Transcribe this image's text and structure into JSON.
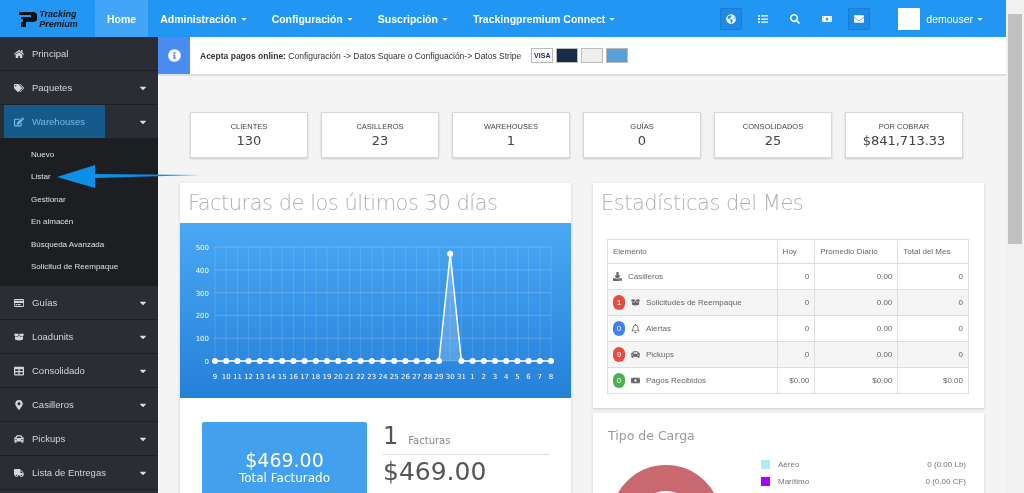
{
  "logo": {
    "line_1": "Tracking",
    "line_2": "Premium"
  },
  "nav": {
    "items": [
      {
        "label": "Home",
        "selected": true
      },
      {
        "label": "Administración",
        "selected": false
      },
      {
        "label": "Configuración",
        "selected": false
      },
      {
        "label": "Suscripción",
        "selected": false
      },
      {
        "label": "Trackingpremium Connect",
        "selected": false
      }
    ],
    "user": "demouser"
  },
  "sidebar": {
    "items": [
      {
        "label": "Principal",
        "selected": false
      },
      {
        "label": "Paquetes",
        "selected": false
      },
      {
        "label": "Warehouses",
        "selected": true,
        "children": [
          {
            "label": "Nuevo"
          },
          {
            "label": "Listar"
          },
          {
            "label": "Gestionar"
          },
          {
            "label": "En almacén"
          },
          {
            "label": "Búsqueda Avanzada"
          },
          {
            "label": "Solicitud de Reempaque"
          }
        ]
      },
      {
        "label": "Guías",
        "selected": false
      },
      {
        "label": "Loadunits",
        "selected": false
      },
      {
        "label": "Consolidado",
        "selected": false
      },
      {
        "label": "Casilleros",
        "selected": false
      },
      {
        "label": "Pickups",
        "selected": false
      },
      {
        "label": "Lista de Entregas",
        "selected": false
      }
    ]
  },
  "alert": {
    "text": "**Acepta pagos online:** Configuración -> Datos Square o Configuación-> Datos Stripe",
    "cards": [
      {
        "kind": "visa",
        "label": "VISA"
      },
      {
        "kind": "mastercard"
      },
      {
        "kind": "discover"
      },
      {
        "kind": "amex"
      }
    ]
  },
  "stats": [
    {
      "label": "CLIENTES",
      "value": "130"
    },
    {
      "label": "CASILLEROS",
      "value": "23"
    },
    {
      "label": "WAREHOUSES",
      "value": "1"
    },
    {
      "label": "GUÍAS",
      "value": "0"
    },
    {
      "label": "CONSOLIDADOS",
      "value": "25"
    },
    {
      "label": "POR COBRAR",
      "value": "$841,713.33"
    }
  ],
  "invoices": {
    "title": "Facturas de los últimos 30 días",
    "chart_data": {
      "type": "area",
      "categories": [
        "9",
        "10",
        "11",
        "12",
        "13",
        "14",
        "15",
        "16",
        "17",
        "18",
        "19",
        "20",
        "21",
        "22",
        "23",
        "24",
        "25",
        "26",
        "27",
        "28",
        "29",
        "30",
        "31",
        "1",
        "2",
        "3",
        "4",
        "5",
        "6",
        "7",
        "8"
      ],
      "series": [
        {
          "color": "#ffffff",
          "values": [
            0,
            0,
            0,
            0,
            0,
            0,
            0,
            0,
            0,
            0,
            0,
            0,
            0,
            0,
            0,
            0,
            0,
            0,
            0,
            0,
            0,
            470,
            0,
            0,
            0,
            0,
            0,
            0,
            0,
            0,
            0
          ]
        }
      ],
      "ylim": [
        0,
        500
      ],
      "grid": true,
      "yticks": [
        0,
        100,
        200,
        300,
        400,
        500
      ]
    },
    "total": {
      "amount": "$469.00",
      "label": "Total Facturado"
    },
    "count": "1",
    "count_label": "Facturas",
    "sum": "$469.00"
  },
  "month_stats": {
    "title": "Estadísticas del Mes",
    "columns": [
      "Elemento",
      "Hoy",
      "Promedio Diario",
      "Total del Mes"
    ],
    "rows": [
      {
        "cells": [
          "Casilleros",
          "0",
          "0.00",
          "0"
        ]
      },
      {
        "badge": "1",
        "color": "#e74c3c",
        "cells": [
          "Solicitudes de Reempaque",
          "0",
          "0.00",
          "0"
        ]
      },
      {
        "badge": "0",
        "color": "#3b82f6",
        "cells": [
          "Alertas",
          "0",
          "0.00",
          "0"
        ]
      },
      {
        "badge": "9",
        "color": "#e74c3c",
        "cells": [
          "Pickups",
          "0",
          "0.00",
          "0"
        ]
      },
      {
        "badge": "0",
        "color": "#4caf50",
        "cells": [
          "Pagos Recibidos",
          "$0.00",
          "$0.00",
          "$0.00"
        ]
      }
    ]
  },
  "cargo": {
    "title": "Tipo de Carga",
    "legend": [
      {
        "label": "Aéreo",
        "value": "0 (0.00 Lb)",
        "color": "#b2ebee"
      },
      {
        "label": "Marítimo",
        "value": "0 (0.00 CF)",
        "color": "#aa00ff"
      }
    ]
  }
}
